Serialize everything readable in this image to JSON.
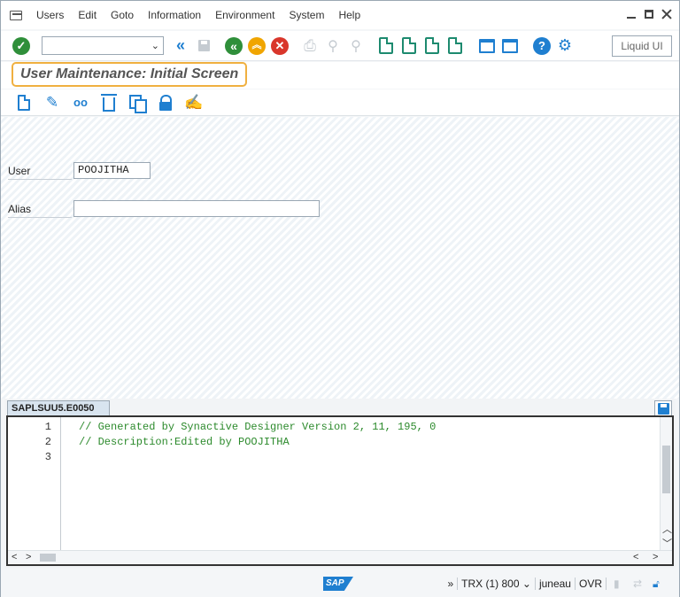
{
  "menu": {
    "items": [
      {
        "label": "Users"
      },
      {
        "label": "Edit"
      },
      {
        "label": "Goto"
      },
      {
        "label": "Information"
      },
      {
        "label": "Environment"
      },
      {
        "label": "System"
      },
      {
        "label": "Help"
      }
    ]
  },
  "toolbar": {
    "command_field_value": "",
    "liquid_ui_label": "Liquid UI",
    "icons": [
      "enter-icon",
      "back-nav-icon",
      "save-icon",
      "back-icon",
      "exit-icon",
      "cancel-icon",
      "print-icon",
      "find-icon",
      "find-next-icon",
      "first-page-icon",
      "previous-page-icon",
      "next-page-icon",
      "last-page-icon",
      "create-session-icon",
      "shortcut-icon",
      "help-icon",
      "customize-layout-icon"
    ]
  },
  "screen": {
    "title": "User Maintenance: Initial Screen"
  },
  "app_toolbar": {
    "icons": [
      "create-icon",
      "change-icon",
      "display-icon",
      "delete-icon",
      "copy-icon",
      "lock-unlock-icon",
      "change-documents-icon"
    ]
  },
  "form": {
    "user_label": "User",
    "user_value": "POOJITHA",
    "alias_label": "Alias",
    "alias_value": ""
  },
  "editor": {
    "tab_label": "SAPLSUU5.E0050",
    "lines": [
      {
        "num": "1",
        "text": "// Generated by Synactive Designer Version 2, 11, 195, 0"
      },
      {
        "num": "2",
        "text": "// Description:Edited by POOJITHA"
      },
      {
        "num": "3",
        "text": ""
      }
    ]
  },
  "status": {
    "logo": "SAP",
    "expand": "»",
    "system": "TRX (1) 800",
    "server": "juneau",
    "mode": "OVR"
  },
  "colors": {
    "accent_blue": "#1f7fd0",
    "green": "#2f8f3a",
    "orange": "#f0a500",
    "red": "#d9362b",
    "title_highlight": "#f0b040",
    "code_comment": "#2c8a2c"
  }
}
